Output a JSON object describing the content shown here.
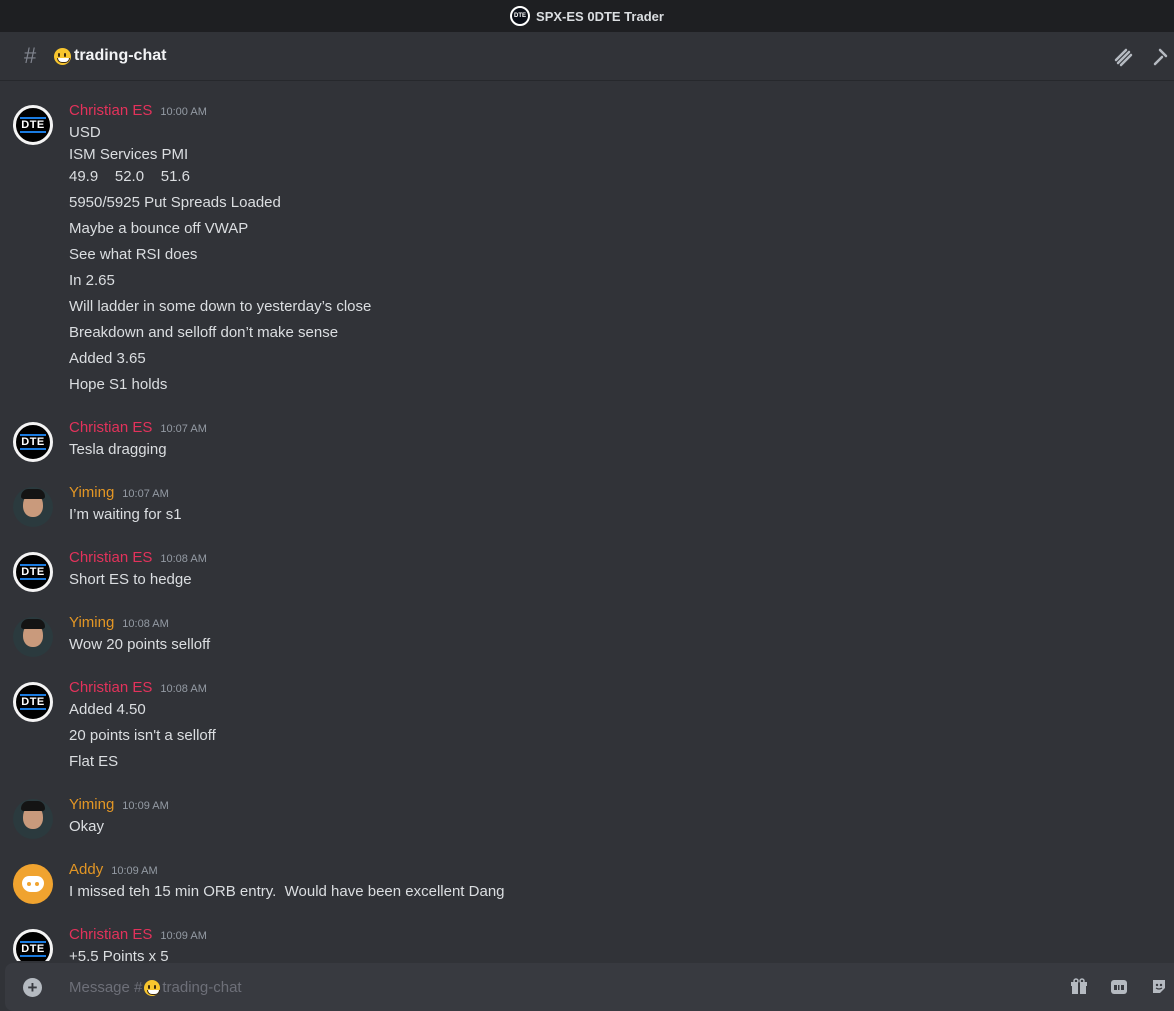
{
  "window": {
    "title": "SPX-ES 0DTE Trader"
  },
  "server_logo_text": "DTE",
  "channel": {
    "name": "trading-chat"
  },
  "messages": [
    {
      "author": "Christian ES",
      "time": "10:00 AM",
      "lines": [
        "USD",
        "ISM Services PMI",
        "49.9    52.0    51.6",
        "5950/5925 Put Spreads Loaded",
        "Maybe a bounce off VWAP",
        "See what RSI does",
        "In 2.65",
        "Will ladder in some down to yesterday’s close",
        "Breakdown and selloff don’t make sense",
        "Added 3.65",
        "Hope S1 holds"
      ]
    },
    {
      "author": "Christian ES",
      "time": "10:07 AM",
      "lines": [
        "Tesla dragging"
      ]
    },
    {
      "author": "Yiming",
      "time": "10:07 AM",
      "lines": [
        "I’m waiting for s1"
      ]
    },
    {
      "author": "Christian ES",
      "time": "10:08 AM",
      "lines": [
        "Short ES to hedge"
      ]
    },
    {
      "author": "Yiming",
      "time": "10:08 AM",
      "lines": [
        "Wow 20 points selloff"
      ]
    },
    {
      "author": "Christian ES",
      "time": "10:08 AM",
      "lines": [
        "Added 4.50",
        "20 points isn't a selloff",
        "Flat ES"
      ]
    },
    {
      "author": "Yiming",
      "time": "10:09 AM",
      "lines": [
        "Okay"
      ]
    },
    {
      "author": "Addy",
      "time": "10:09 AM",
      "lines": [
        "I missed teh 15 min ORB entry.  Would have been excellent Dang"
      ]
    },
    {
      "author": "Christian ES",
      "time": "10:09 AM",
      "lines": [
        "+5.5 Points x 5"
      ]
    }
  ],
  "composer": {
    "placeholder_prefix": "Message #",
    "placeholder_channel": "trading-chat"
  },
  "icons": {
    "header": [
      "threads-icon",
      "pin-icon"
    ],
    "composer": [
      "plus-icon",
      "gift-icon",
      "gif-icon",
      "sticker-icon"
    ]
  },
  "colors": {
    "christian": "#e3325b",
    "yiming": "#e29625",
    "addy": "#e29625",
    "background": "#313338"
  }
}
